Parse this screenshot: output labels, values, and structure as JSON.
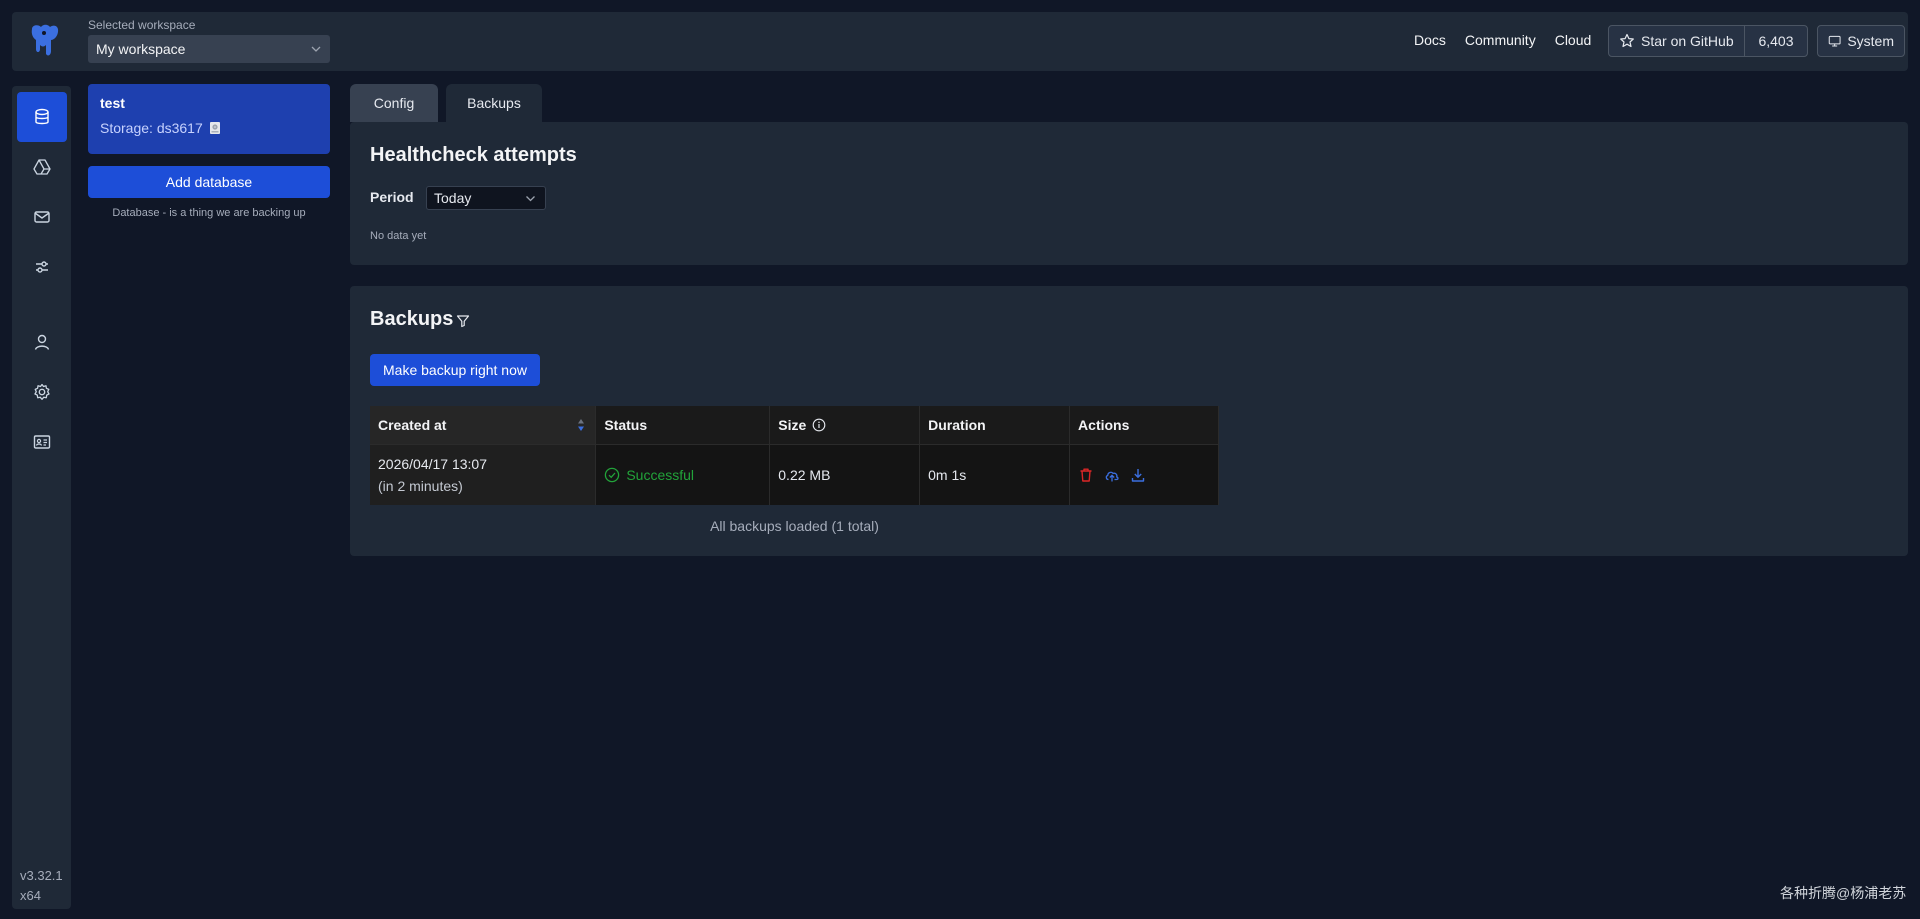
{
  "header": {
    "workspace_label": "Selected workspace",
    "workspace_value": "My workspace",
    "links": [
      "Docs",
      "Community",
      "Cloud"
    ],
    "github_label": "Star on GitHub",
    "github_count": "6,403",
    "theme_label": "System"
  },
  "sidebar": {
    "icons": [
      "database-icon",
      "cloud-drive-icon",
      "mail-icon",
      "sliders-icon",
      "user-icon",
      "gear-icon",
      "id-card-icon"
    ],
    "active": "database-icon",
    "version": "v3.32.1",
    "arch": "x64"
  },
  "databases": {
    "items": [
      {
        "name": "test",
        "storage": "Storage: ds3617"
      }
    ],
    "add_label": "Add database",
    "hint": "Database - is a thing we are backing up"
  },
  "tabs": {
    "config": "Config",
    "backups": "Backups",
    "active": "Backups"
  },
  "healthcheck": {
    "title": "Healthcheck attempts",
    "period_label": "Period",
    "period_value": "Today",
    "empty": "No data yet"
  },
  "backups": {
    "title": "Backups",
    "make_label": "Make backup right now",
    "columns": [
      "Created at",
      "Status",
      "Size",
      "Duration",
      "Actions"
    ],
    "rows": [
      {
        "created": "2026/04/17 13:07",
        "created_rel": "(in 2 minutes)",
        "status": "Successful",
        "size": "0.22 MB",
        "duration": "0m 1s"
      }
    ],
    "footer": "All backups loaded (1 total)",
    "colors": {
      "success": "#22a33a",
      "delete": "#dc2626",
      "accent": "#1d4ed8"
    }
  },
  "watermark": "各种折腾@杨浦老苏"
}
